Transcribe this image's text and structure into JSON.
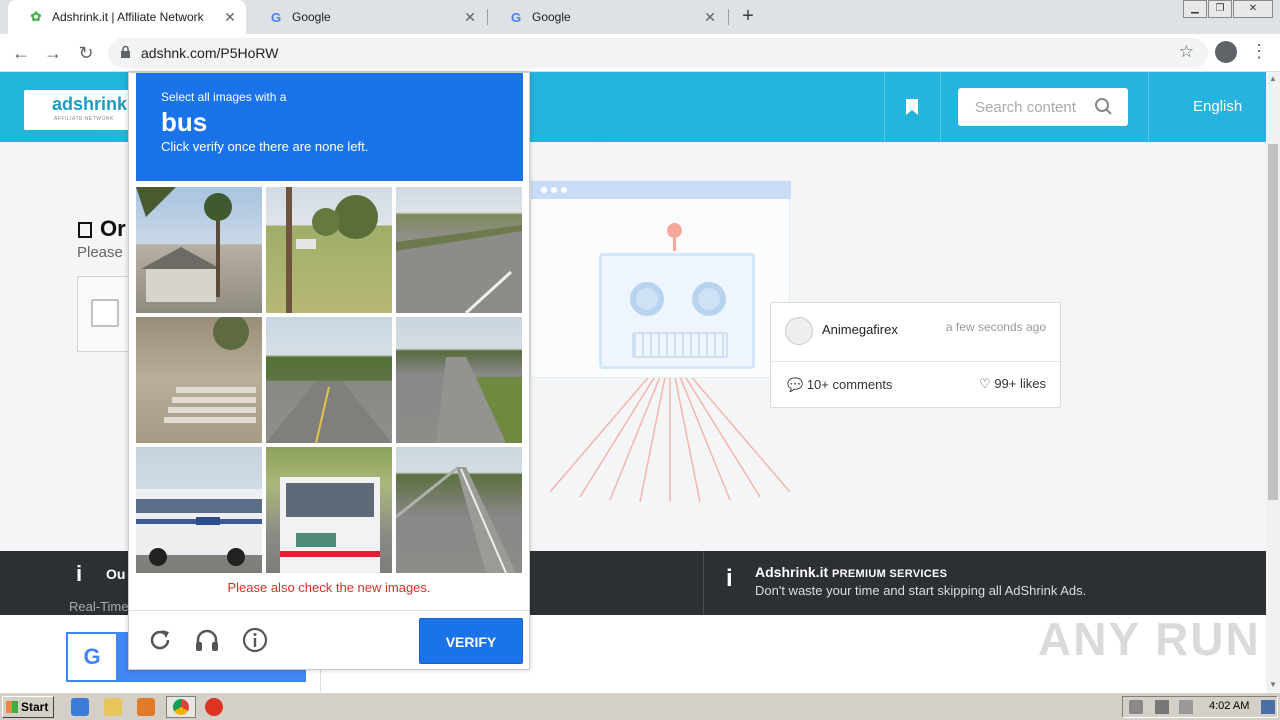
{
  "browser": {
    "tabs": [
      {
        "title": "Adshrink.it | Affiliate Network",
        "active": true
      },
      {
        "title": "Google",
        "active": false
      },
      {
        "title": "Google",
        "active": false
      }
    ],
    "url": "adshnk.com/P5HoRW"
  },
  "site": {
    "logo_text": "adshrink.it",
    "logo_sub": "AFFILIATE NETWORK",
    "search_placeholder": "Search content",
    "language": "English",
    "heading_partial": "Or",
    "please_partial": "Please",
    "card": {
      "author": "Animegafirex",
      "time": "a few seconds ago",
      "comments": "10+ comments",
      "likes": "99+ likes"
    },
    "band": {
      "left_title_partial": "Ou",
      "left_sub_partial": "Real-Time",
      "premium_brand": "Adshrink.it",
      "premium_label": "PREMIUM SERVICES",
      "premium_desc": "Don't waste your time and start skipping all AdShrink Ads."
    },
    "watermark": "ANY RUN"
  },
  "captcha": {
    "instruction_line1": "Select all images with a",
    "target": "bus",
    "instruction_line2": "Click verify once there are none left.",
    "error": "Please also check the new images.",
    "verify_label": "VERIFY",
    "tiles": [
      "house-palm-tree",
      "grass-yard-pole",
      "road-curve",
      "concrete-steps",
      "road-trees",
      "road-median",
      "bus-side",
      "bus-rear",
      "road-railing"
    ]
  },
  "taskbar": {
    "start_label": "Start",
    "clock": "4:02 AM"
  },
  "colors": {
    "captcha_blue": "#1a73e8",
    "site_header": "#20b6d9",
    "error_red": "#d93025"
  }
}
